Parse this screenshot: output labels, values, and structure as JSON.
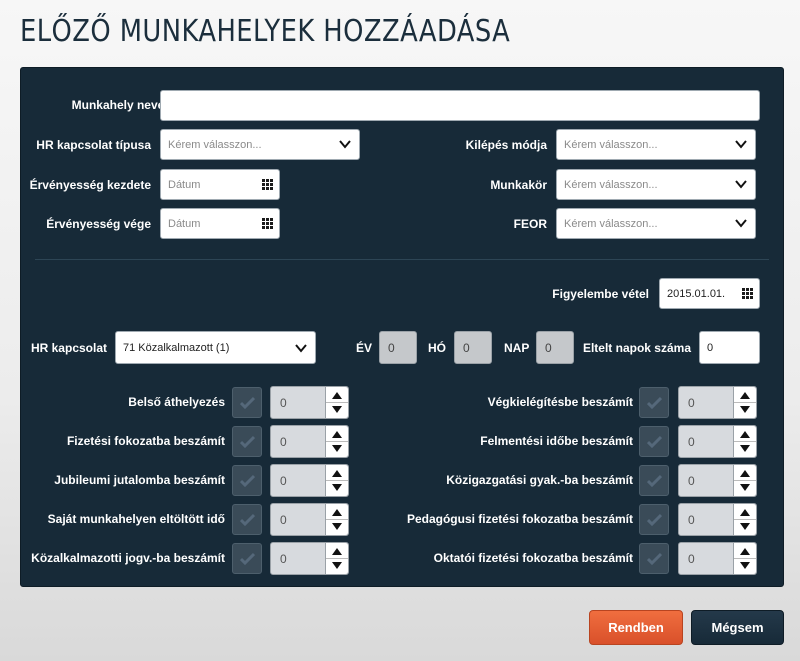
{
  "title": "ELŐZŐ MUNKAHELYEK HOZZÁADÁSA",
  "form": {
    "workplace_name_label": "Munkahely neve*",
    "workplace_name_value": "",
    "hr_type_label": "HR kapcsolat típusa",
    "hr_type_placeholder": "Kérem válasszon...",
    "exit_mode_label": "Kilépés módja",
    "exit_mode_placeholder": "Kérem válasszon...",
    "valid_from_label": "Érvényesség kezdete",
    "valid_from_placeholder": "Dátum",
    "job_label": "Munkakör",
    "job_placeholder": "Kérem válasszon...",
    "valid_to_label": "Érvényesség vége",
    "valid_to_placeholder": "Dátum",
    "feor_label": "FEOR",
    "feor_placeholder": "Kérem válasszon...",
    "consider_label": "Figyelembe vétel",
    "consider_value": "2015.01.01.",
    "hr_label": "HR kapcsolat",
    "hr_value": "71 Közalkalmazott (1)",
    "year_label": "ÉV",
    "year_value": "0",
    "month_label": "HÓ",
    "month_value": "0",
    "day_label": "NAP",
    "day_value": "0",
    "elapsed_label": "Eltelt napok száma",
    "elapsed_value": "0"
  },
  "left_rows": [
    {
      "label": "Belső áthelyezés",
      "value": "0"
    },
    {
      "label": "Fizetési fokozatba beszámít",
      "value": "0"
    },
    {
      "label": "Jubileumi jutalomba beszámít",
      "value": "0"
    },
    {
      "label": "Saját munkahelyen eltöltött idő",
      "value": "0"
    },
    {
      "label": "Közalkalmazotti jogv.-ba beszámít",
      "value": "0"
    }
  ],
  "right_rows": [
    {
      "label": "Végkielégítésbe beszámít",
      "value": "0"
    },
    {
      "label": "Felmentési időbe beszámít",
      "value": "0"
    },
    {
      "label": "Közigazgatási gyak.-ba beszámít",
      "value": "0"
    },
    {
      "label": "Pedagógusi fizetési fokozatba beszámít",
      "value": "0"
    },
    {
      "label": "Oktatói fizetési fokozatba beszámít",
      "value": "0"
    }
  ],
  "buttons": {
    "ok": "Rendben",
    "cancel": "Mégsem"
  },
  "colors": {
    "panel": "#172a38",
    "accent": "#e0562c",
    "title": "#1b2e3c"
  }
}
